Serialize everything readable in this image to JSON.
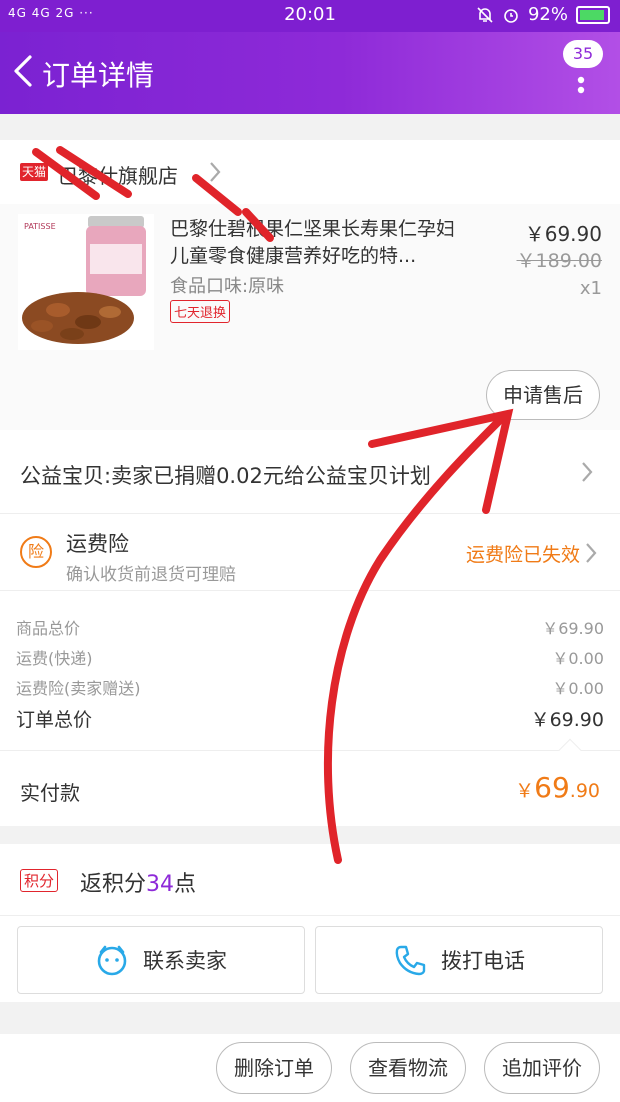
{
  "status_bar": {
    "signal": "4G 4G 2G ···",
    "time": "20:01",
    "battery": "92%",
    "battery_level": 0.92
  },
  "header": {
    "title": "订单详情",
    "badge_count": "35"
  },
  "store": {
    "tmall_badge": "天猫",
    "name": "巴黎仕旗舰店"
  },
  "product": {
    "title": "巴黎仕碧根果仁坚果长寿果仁孕妇儿童零食健康营养好吃的特...",
    "spec": "食品口味:原味",
    "tag": "七天退换",
    "price": "￥69.90",
    "original_price": "￥189.00",
    "quantity": "x1",
    "thumb_brand": "PATISSE",
    "after_sale_button": "申请售后"
  },
  "charity": {
    "text": "公益宝贝:卖家已捐赠0.02元给公益宝贝计划"
  },
  "insurance": {
    "icon_label": "险",
    "title": "运费险",
    "subtitle": "确认收货前退货可理赔",
    "status": "运费险已失效"
  },
  "totals": {
    "rows": [
      {
        "label": "商品总价",
        "value": "￥69.90"
      },
      {
        "label": "运费(快递)",
        "value": "￥0.00"
      },
      {
        "label": "运费险(卖家赠送)",
        "value": "￥0.00"
      }
    ],
    "order_total_label": "订单总价",
    "order_total_value": "￥69.90"
  },
  "paid": {
    "label": "实付款",
    "currency": "￥",
    "integer": "69",
    "decimal": ".90"
  },
  "points": {
    "icon_label": "积分",
    "prefix": "返积分",
    "number": "34",
    "suffix": "点"
  },
  "contact": {
    "seller_label": "联系卖家",
    "phone_label": "拨打电话"
  },
  "actions": {
    "delete": "删除订单",
    "logistics": "查看物流",
    "review": "追加评价"
  },
  "colors": {
    "brand_purple": "#8e2ad8",
    "accent_orange": "#f07b17",
    "tmall_red": "#e1252d",
    "annotation_red": "#e0242a"
  }
}
